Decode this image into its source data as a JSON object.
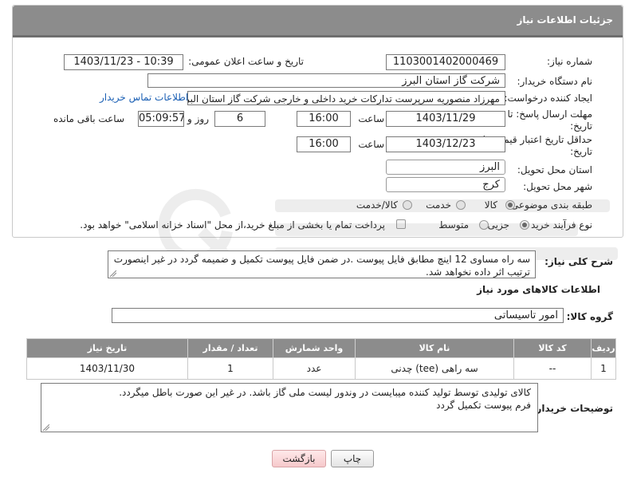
{
  "header": {
    "title": "جزئیات اطلاعات نیاز"
  },
  "fields": {
    "need_number_label": "شماره نیاز:",
    "need_number": "1103001402000469",
    "announce_label": "تاریخ و ساعت اعلان عمومی:",
    "announce_value": "1403/11/23 - 10:39",
    "buyer_org_label": "نام دستگاه خریدار:",
    "buyer_org": "شرکت گاز استان البرز",
    "creator_label": "ایجاد کننده درخواست:",
    "creator": "مهرزاد منصوریه سرپرست تدارکات خرید داخلی و خارجی شرکت گاز استان البرز",
    "contact_link": "اطلاعات تماس خریدار",
    "deadline_label_1": "مهلت ارسال پاسخ: تا",
    "deadline_label_2": "تاریخ:",
    "deadline_date": "1403/11/29",
    "time_label": "ساعت",
    "deadline_time": "16:00",
    "days_value": "6",
    "days_label": "روز و",
    "remaining_value": "05:09:57",
    "remaining_label": "ساعت باقی مانده",
    "validity_label_1": "حداقل تاریخ اعتبار قیمت: تا",
    "validity_label_2": "تاریخ:",
    "validity_date": "1403/12/23",
    "validity_time": "16:00",
    "province_label": "استان محل تحویل:",
    "province": "البرز",
    "city_label": "شهر محل تحویل:",
    "city": "کرج",
    "category_label": "طبقه بندی موضوعی:",
    "category_options": [
      "کالا",
      "خدمت",
      "کالا/خدمت"
    ],
    "category_selected": "کالا",
    "process_label": "نوع فرآیند خرید :",
    "process_options": [
      "جزیی",
      "متوسط"
    ],
    "process_selected": "جزیی",
    "payment_note": "پرداخت تمام یا بخشی از مبلغ خرید،از محل \"اسناد خزانه اسلامی\" خواهد بود."
  },
  "description": {
    "label": "شرح کلی نیاز:",
    "text": "سه راه مساوی 12 اینچ مطابق فایل پیوست .در ضمن فایل پیوست تکمیل و ضمیمه گردد در غیر اینصورت ترتیب اثر داده نخواهد شد."
  },
  "goods": {
    "section_title": "اطلاعات کالاهای مورد نیاز",
    "group_label": "گروه کالا:",
    "group_value": "امور تاسیساتی",
    "columns": [
      "ردیف",
      "کد کالا",
      "نام کالا",
      "واحد شمارش",
      "تعداد / مقدار",
      "تاریخ نیاز"
    ],
    "rows": [
      [
        "1",
        "--",
        "سه راهی (tee) چدنی",
        "عدد",
        "1",
        "1403/11/30"
      ]
    ]
  },
  "buyer_notes": {
    "label": "توضیحات خریدار:",
    "line1": "کالای تولیدی توسط تولید کننده میبایست در وندور لیست ملی گاز باشد. در غیر این صورت باطل میگردد.",
    "line2": "فرم پیوست تکمیل گردد"
  },
  "buttons": {
    "print": "چاپ",
    "back": "بازگشت"
  },
  "colors": {
    "header_bg": "#8c8c8c",
    "link": "#1a5fb4",
    "back_button": "#f6c9cb"
  }
}
